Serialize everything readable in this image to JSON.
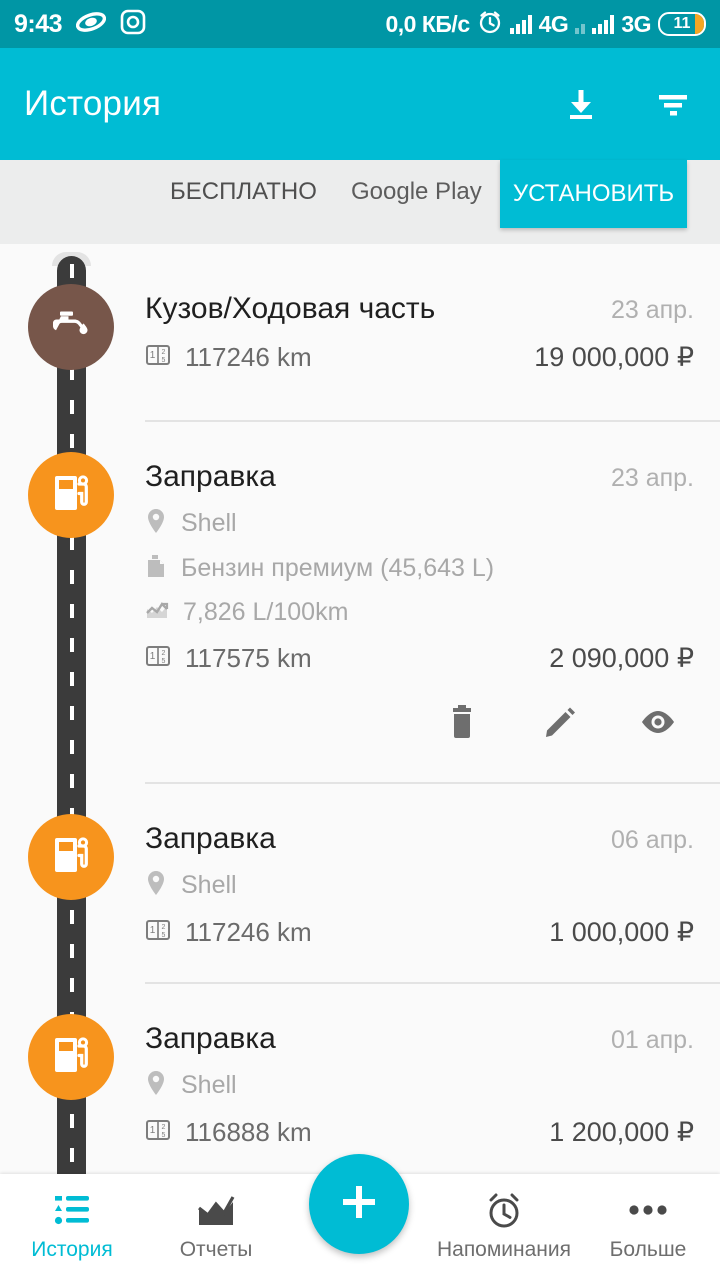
{
  "statusbar": {
    "time": "9:43",
    "network_speed": "0,0 КБ/с",
    "sim1_label": "4G",
    "sim2_label": "3G",
    "battery_level": "11",
    "icons": [
      "opera-icon",
      "instagram-icon",
      "alarm-clock-icon",
      "signal-bars-icon",
      "battery-icon"
    ],
    "bg_color": "#0096a5"
  },
  "appbar": {
    "title": "История",
    "download_icon": "download-icon",
    "filter_icon": "filter-icon",
    "bg_color": "#00bcd4"
  },
  "ad": {
    "free_label": "БЕСПЛАТНО",
    "store_label": "Google Play",
    "install_label": "УСТАНОВИТЬ",
    "button_color": "#00bcd4"
  },
  "entries": [
    {
      "title": "Кузов/Ходовая часть",
      "date": "23 апр.",
      "marker_icon": "oil-can-icon",
      "marker_color": "#77564a",
      "details": [],
      "odometer": "117246 km",
      "price": "19 000,000 ₽",
      "expanded": false
    },
    {
      "title": "Заправка",
      "date": "23 апр.",
      "marker_icon": "fuel-pump-icon",
      "marker_color": "#f7941d",
      "details": [
        {
          "icon": "location-pin-icon",
          "text": "Shell"
        },
        {
          "icon": "fuel-canister-icon",
          "text": "Бензин премиум (45,643 L)"
        },
        {
          "icon": "consumption-chart-icon",
          "text": "7,826 L/100km"
        }
      ],
      "odometer": "117575 km",
      "price": "2 090,000 ₽",
      "expanded": true,
      "actions": [
        {
          "name": "delete-icon",
          "label": "Удалить"
        },
        {
          "name": "edit-icon",
          "label": "Редактировать"
        },
        {
          "name": "view-icon",
          "label": "Просмотр"
        }
      ]
    },
    {
      "title": "Заправка",
      "date": "06 апр.",
      "marker_icon": "fuel-pump-icon",
      "marker_color": "#f7941d",
      "details": [
        {
          "icon": "location-pin-icon",
          "text": "Shell"
        }
      ],
      "odometer": "117246 km",
      "price": "1 000,000 ₽",
      "expanded": false
    },
    {
      "title": "Заправка",
      "date": "01 апр.",
      "marker_icon": "fuel-pump-icon",
      "marker_color": "#f7941d",
      "details": [
        {
          "icon": "location-pin-icon",
          "text": "Shell"
        }
      ],
      "odometer": "116888 km",
      "price": "1 200,000 ₽",
      "expanded": false
    }
  ],
  "bottomnav": {
    "items": [
      {
        "label": "История",
        "icon": "history-list-icon",
        "active": true
      },
      {
        "label": "Отчеты",
        "icon": "reports-chart-icon",
        "active": false
      },
      {
        "label": "Напоминания",
        "icon": "alarm-clock-icon",
        "active": false
      },
      {
        "label": "Больше",
        "icon": "more-dots-icon",
        "active": false
      }
    ],
    "fab_icon": "plus-icon",
    "active_color": "#00bcd4"
  }
}
